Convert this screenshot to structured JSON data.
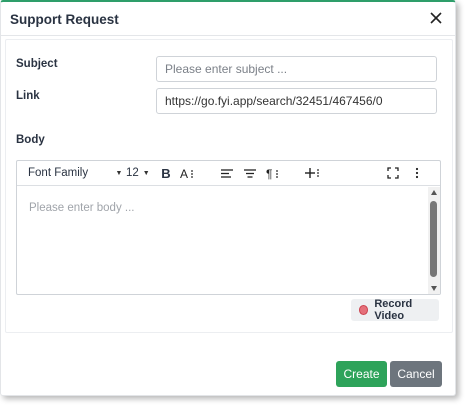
{
  "dialog": {
    "title": "Support Request"
  },
  "form": {
    "subject_label": "Subject",
    "subject_placeholder": "Please enter subject ...",
    "subject_value": "",
    "link_label": "Link",
    "link_value": "https://go.fyi.app/search/32451/467456/0",
    "body_label": "Body"
  },
  "editor": {
    "toolbar": {
      "font_family": "Font Family",
      "font_size": "12",
      "bold": "B",
      "font_style_icon": "text-style-icon",
      "align_icon": "align-left-icon",
      "format_icon": "align-center-icon",
      "paragraph_icon": "paragraph-icon",
      "insert_icon": "insert-plus-icon",
      "fullscreen_icon": "fullscreen-icon",
      "more_icon": "more-vertical-icon"
    },
    "placeholder": "Please enter body ..."
  },
  "record_video": {
    "label": "Record Video",
    "dot_color": "#e5707a"
  },
  "actions": {
    "create_label": "Create",
    "cancel_label": "Cancel"
  },
  "colors": {
    "accent": "#2e9e6a",
    "create": "#2ea35a",
    "cancel": "#6d757d"
  }
}
